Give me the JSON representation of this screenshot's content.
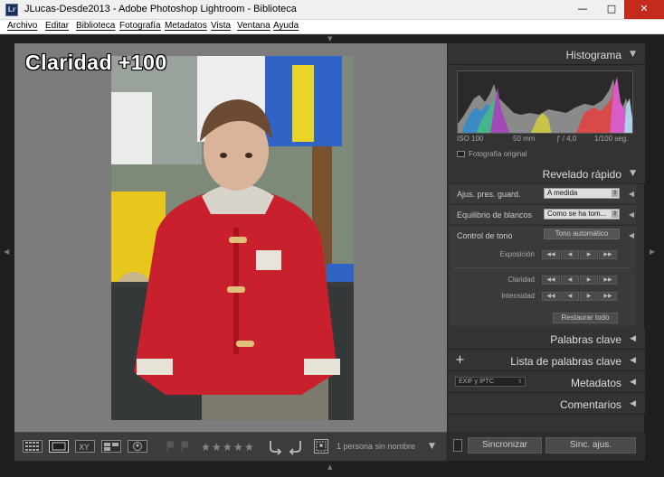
{
  "window": {
    "title": "JLucas-Desde2013 - Adobe Photoshop Lightroom - Biblioteca",
    "app_icon": "Lr",
    "min_glyph": "—",
    "max_glyph": "□",
    "close_glyph": "✕"
  },
  "menu": [
    "Archivo",
    "Editar",
    "Biblioteca",
    "Fotografía",
    "Metadatos",
    "Vista",
    "Ventana",
    "Ayuda"
  ],
  "loupe": {
    "overlay": "Claridad +100"
  },
  "toolbar": {
    "people_label": "1 persona sin nombre"
  },
  "panels": {
    "histogram": {
      "title": "Histograma",
      "iso": "ISO 100",
      "focal": "50 mm",
      "aperture": "ƒ / 4,0",
      "shutter": "1/100 seg.",
      "original_label": "Fotografía original"
    },
    "quick_develop": {
      "title": "Revelado rápido",
      "preset_label": "Ajus. pres. guard.",
      "preset_value": "A medida",
      "wb_label": "Equilibrio de blancos",
      "wb_value": "Como se ha tom...",
      "tone_label": "Control de tono",
      "auto_tone": "Tono automático",
      "exposure": "Exposición",
      "clarity": "Claridad",
      "vibrance": "Intensidad",
      "reset": "Restaurar todo"
    },
    "keywording": {
      "title": "Palabras clave"
    },
    "keyword_list": {
      "title": "Lista de palabras clave"
    },
    "metadata": {
      "title": "Metadatos",
      "preset": "EXIF y IPTC"
    },
    "comments": {
      "title": "Comentarios"
    }
  },
  "bottom": {
    "sync": "Sincronizar",
    "sync_settings": "Sinc. ajus."
  },
  "colors": {
    "panel_bg": "#333333",
    "loupe_bg": "#7c7c7c",
    "close_red": "#c42b1c"
  }
}
